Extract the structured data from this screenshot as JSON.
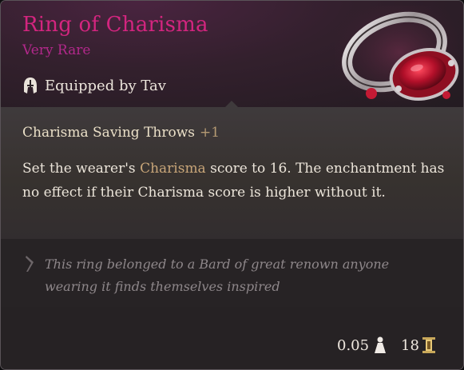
{
  "item": {
    "name": "Ring of Charisma",
    "rarity": "Very Rare",
    "equipped_text": "Equipped by Tav",
    "image_icon": "ring-icon"
  },
  "bonus": {
    "label": "Charisma Saving Throws",
    "value": "+1"
  },
  "description": {
    "part1": "Set the wearer's ",
    "highlight": "Charisma",
    "part2": " score to 16. The enchantment has no effect if their Charisma score is higher without it."
  },
  "lore": {
    "text": "This ring belonged to a Bard of great renown anyone wearing it finds themselves inspired"
  },
  "footer": {
    "weight": "0.05",
    "weight_icon": "weight-icon",
    "value": "18",
    "value_icon": "coin-icon"
  },
  "colors": {
    "title": "#d3257f",
    "rarity": "#b2288b",
    "highlight": "#c9a679"
  }
}
